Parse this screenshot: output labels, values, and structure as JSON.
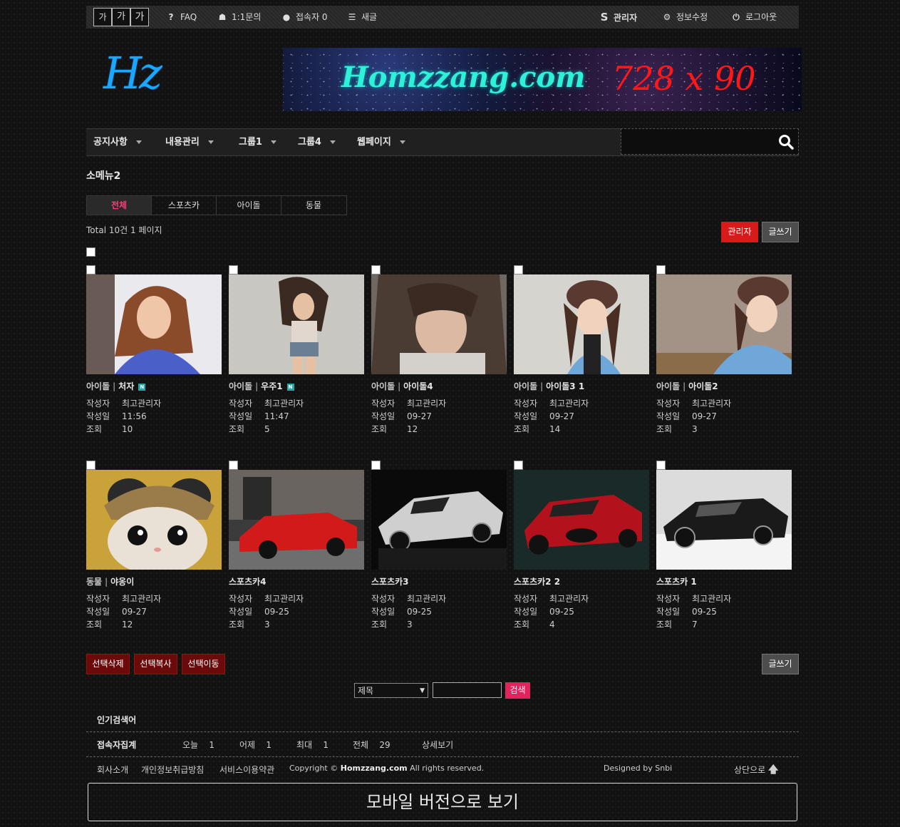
{
  "topbar": {
    "font_sizes": [
      "가",
      "가",
      "가"
    ],
    "left_items": [
      {
        "label": "FAQ",
        "icon": "question-icon"
      },
      {
        "label": "1:1문의",
        "icon": "support-icon"
      },
      {
        "label": "접속자 0",
        "icon": "user-icon"
      },
      {
        "label": "새글",
        "icon": "list-icon"
      }
    ],
    "right_items": [
      {
        "label": "관리자",
        "icon": "s-admin-icon"
      },
      {
        "label": "정보수정",
        "icon": "gear-icon"
      },
      {
        "label": "로그아웃",
        "icon": "power-icon"
      }
    ]
  },
  "logo": {
    "text": "Hz"
  },
  "banner": {
    "site": "Homzzang.com",
    "size": "728 x 90"
  },
  "mainnav": [
    "공지사항",
    "내용관리",
    "그룹1",
    "그룹4",
    "웹페이지"
  ],
  "page": {
    "title": "소메뉴2",
    "tabs": [
      "전체",
      "스포츠카",
      "아이돌",
      "동물"
    ],
    "total": "Total 10건 1 페이지",
    "admin_button": "관리자",
    "write_button": "글쓰기"
  },
  "meta_labels": {
    "author": "작성자",
    "date": "작성일",
    "views": "조회"
  },
  "posts": [
    {
      "category": "아이돌",
      "title": "처자",
      "author": "최고관리자",
      "date": "11:56",
      "views": "10",
      "new": true
    },
    {
      "category": "아이돌",
      "title": "우주1",
      "author": "최고관리자",
      "date": "11:47",
      "views": "5",
      "new": true
    },
    {
      "category": "아이돌",
      "title": "아이돌4",
      "author": "최고관리자",
      "date": "09-27",
      "views": "12",
      "new": false
    },
    {
      "category": "아이돌",
      "title": "아이돌3 1",
      "author": "최고관리자",
      "date": "09-27",
      "views": "14",
      "new": false
    },
    {
      "category": "아이돌",
      "title": "아이돌2",
      "author": "최고관리자",
      "date": "09-27",
      "views": "3",
      "new": false
    },
    {
      "category": "동물",
      "title": "야옹이",
      "author": "최고관리자",
      "date": "09-27",
      "views": "12",
      "new": false
    },
    {
      "category": "",
      "title": "스포츠카4",
      "author": "최고관리자",
      "date": "09-25",
      "views": "3",
      "new": false
    },
    {
      "category": "",
      "title": "스포츠카3",
      "author": "최고관리자",
      "date": "09-25",
      "views": "3",
      "new": false
    },
    {
      "category": "",
      "title": "스포츠카2 2",
      "author": "최고관리자",
      "date": "09-25",
      "views": "4",
      "new": false
    },
    {
      "category": "",
      "title": "스포츠카 1",
      "author": "최고관리자",
      "date": "09-25",
      "views": "7",
      "new": false
    }
  ],
  "actions": {
    "delete": "선택삭제",
    "copy": "선택복사",
    "move": "선택이동",
    "write": "글쓰기"
  },
  "search": {
    "field": "제목",
    "button": "검색"
  },
  "popular": {
    "label": "인기검색어"
  },
  "visitors": {
    "label": "접속자집계",
    "today_label": "오늘",
    "today": "1",
    "yesterday_label": "어제",
    "yesterday": "1",
    "max_label": "최대",
    "max": "1",
    "total_label": "전체",
    "total": "29",
    "detail": "상세보기"
  },
  "footer": {
    "links": [
      "회사소개",
      "개인정보취급방침",
      "서비스이용약관"
    ],
    "copyright_prefix": "Copyright ©",
    "copyright_site": "Homzzang.com",
    "copyright_suffix": "All rights reserved.",
    "designed": "Designed by Snbi",
    "top": "상단으로"
  },
  "mobile_button": "모바일 버전으로 보기",
  "colors": {
    "accent_red": "#d91a1a",
    "pink": "#e0245e",
    "logo_blue": "#1aa7ff"
  }
}
